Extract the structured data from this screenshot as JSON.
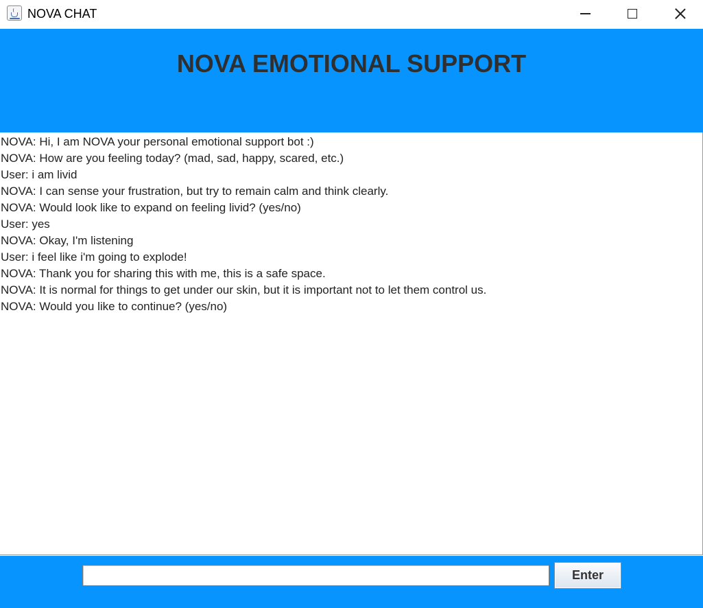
{
  "window": {
    "title": "NOVA CHAT",
    "icon": "java-cup-icon",
    "controls": [
      "minimize-icon",
      "maximize-icon",
      "close-icon"
    ]
  },
  "header": {
    "title": "NOVA EMOTIONAL SUPPORT"
  },
  "chat": {
    "messages": [
      "NOVA: Hi, I am NOVA your personal emotional support bot :)",
      "NOVA: How are you feeling today? (mad, sad, happy, scared, etc.)",
      "User: i am livid",
      "NOVA: I can sense your frustration, but try to remain calm and think clearly.",
      "NOVA: Would look like to expand on feeling livid? (yes/no)",
      "User: yes",
      "NOVA: Okay, I'm listening",
      "User: i feel like i'm going to explode!",
      "NOVA: Thank you for sharing this with me, this is a safe space.",
      "NOVA: It is normal for things to get under our skin, but it is important not to let them control us.",
      "NOVA: Would you like to continue? (yes/no)"
    ]
  },
  "footer": {
    "input_value": "",
    "enter_label": "Enter"
  },
  "colors": {
    "accent_blue": "#0894ff",
    "title_text": "#2f2f2f"
  }
}
